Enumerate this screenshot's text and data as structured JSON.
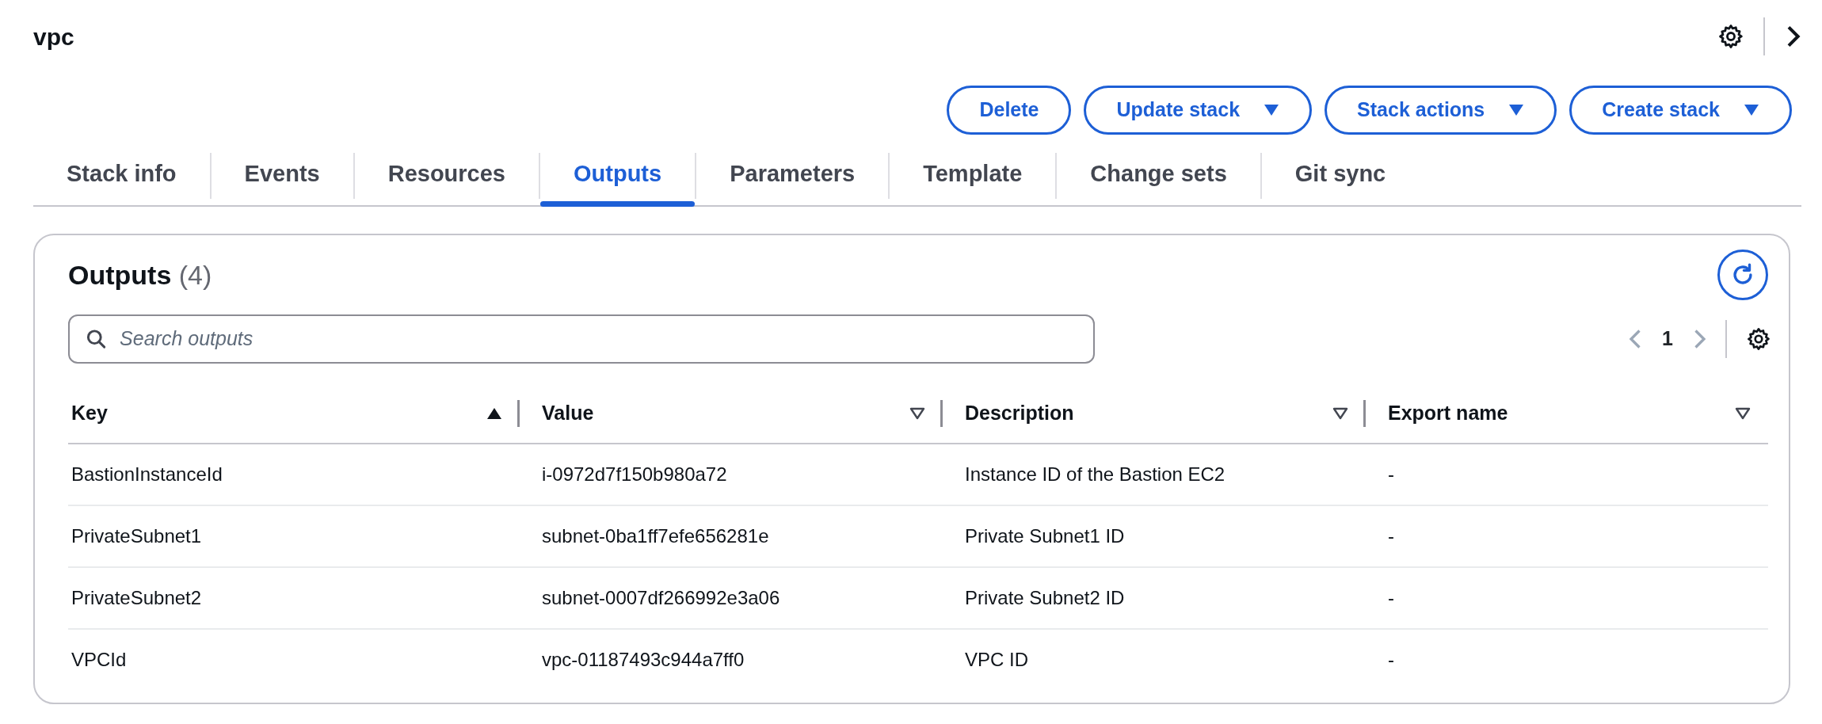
{
  "page": {
    "title": "vpc"
  },
  "actions": [
    {
      "label": "Delete",
      "dropdown": false
    },
    {
      "label": "Update stack",
      "dropdown": true
    },
    {
      "label": "Stack actions",
      "dropdown": true
    },
    {
      "label": "Create stack",
      "dropdown": true
    }
  ],
  "tabs": [
    {
      "label": "Stack info",
      "selected": false
    },
    {
      "label": "Events",
      "selected": false
    },
    {
      "label": "Resources",
      "selected": false
    },
    {
      "label": "Outputs",
      "selected": true
    },
    {
      "label": "Parameters",
      "selected": false
    },
    {
      "label": "Template",
      "selected": false
    },
    {
      "label": "Change sets",
      "selected": false
    },
    {
      "label": "Git sync",
      "selected": false
    }
  ],
  "panel": {
    "title": "Outputs",
    "count": "(4)",
    "search": {
      "placeholder": "Search outputs"
    },
    "page": "1"
  },
  "table": {
    "columns": [
      {
        "label": "Key",
        "sorted": true
      },
      {
        "label": "Value",
        "sorted": false
      },
      {
        "label": "Description",
        "sorted": false
      },
      {
        "label": "Export name",
        "sorted": false
      }
    ],
    "rows": [
      [
        "BastionInstanceId",
        "i-0972d7f150b980a72",
        "Instance ID of the Bastion EC2",
        "-"
      ],
      [
        "PrivateSubnet1",
        "subnet-0ba1ff7efe656281e",
        "Private Subnet1 ID",
        "-"
      ],
      [
        "PrivateSubnet2",
        "subnet-0007df266992e3a06",
        "Private Subnet2 ID",
        "-"
      ],
      [
        "VPCId",
        "vpc-01187493c944a7ff0",
        "VPC ID",
        "-"
      ]
    ]
  }
}
